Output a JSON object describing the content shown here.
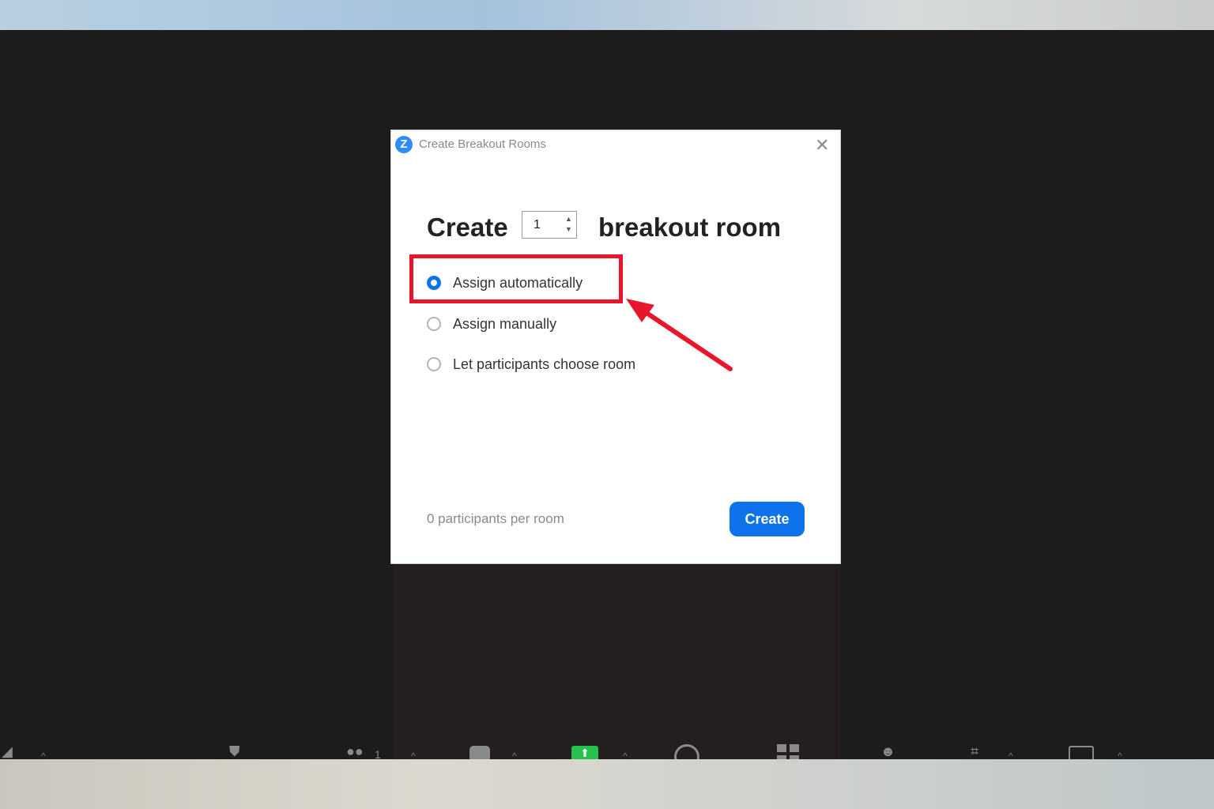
{
  "dialog": {
    "title": "Create Breakout Rooms",
    "close_icon": "close-icon",
    "app_icon_letter": "Z",
    "heading_prefix": "Create",
    "room_count": "1",
    "heading_suffix": "breakout room",
    "options": [
      {
        "label": "Assign automatically",
        "checked": true
      },
      {
        "label": "Assign manually",
        "checked": false
      },
      {
        "label": "Let participants choose room",
        "checked": false
      }
    ],
    "participants_per_room": "0 participants per room",
    "create_button": "Create"
  },
  "toolbar": {
    "participants_count": "1"
  },
  "colors": {
    "accent": "#0e72ed",
    "annotation": "#e8162b",
    "share_green": "#25c14c",
    "window_bg": "#1c1c1c"
  }
}
